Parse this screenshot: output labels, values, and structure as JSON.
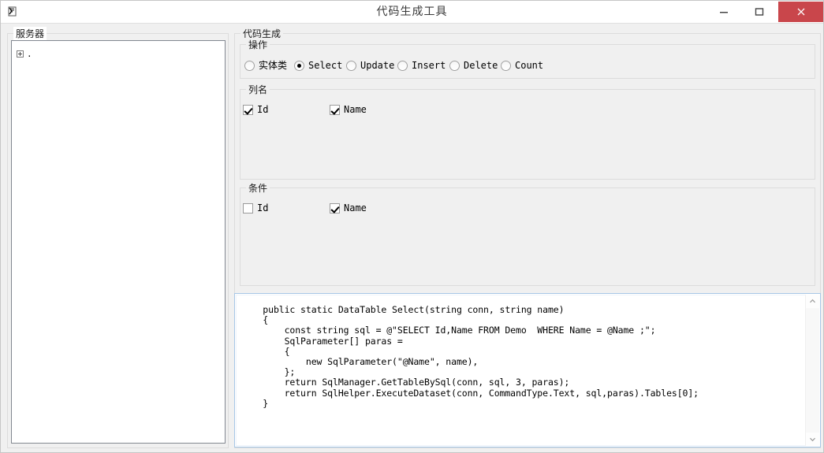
{
  "window": {
    "title": "代码生成工具",
    "icon": "form-icon",
    "controls": {
      "minimize": "minimize-button",
      "maximize": "maximize-button",
      "close": "close-button"
    },
    "close_color": "#c9464b"
  },
  "server_panel": {
    "label": "服务器",
    "tree": {
      "nodes": [
        {
          "expander": "+",
          "label": "."
        }
      ]
    }
  },
  "codegen": {
    "label": "代码生成",
    "action_group": {
      "label": "操作",
      "options": [
        {
          "label": "实体类",
          "checked": false,
          "cjk": true
        },
        {
          "label": "Select",
          "checked": true,
          "cjk": false
        },
        {
          "label": "Update",
          "checked": false,
          "cjk": false
        },
        {
          "label": "Insert",
          "checked": false,
          "cjk": false
        },
        {
          "label": "Delete",
          "checked": false,
          "cjk": false
        },
        {
          "label": "Count",
          "checked": false,
          "cjk": false
        }
      ]
    },
    "columns_group": {
      "label": "列名",
      "items": [
        {
          "label": "Id",
          "checked": true
        },
        {
          "label": "Name",
          "checked": true
        }
      ]
    },
    "condition_group": {
      "label": "条件",
      "items": [
        {
          "label": "Id",
          "checked": false
        },
        {
          "label": "Name",
          "checked": true
        }
      ]
    },
    "code_output": {
      "text": "    public static DataTable Select(string conn, string name)\n    {\n        const string sql = @\"SELECT Id,Name FROM Demo  WHERE Name = @Name ;\";\n        SqlParameter[] paras =\n        {\n            new SqlParameter(\"@Name\", name),\n        };\n        return SqlManager.GetTableBySql(conn, sql, 3, paras);\n        return SqlHelper.ExecuteDataset(conn, CommandType.Text, sql,paras).Tables[0];\n    }",
      "scrollbar": {
        "up_arrow": "chevron-up-icon",
        "down_arrow": "chevron-down-icon"
      }
    }
  }
}
